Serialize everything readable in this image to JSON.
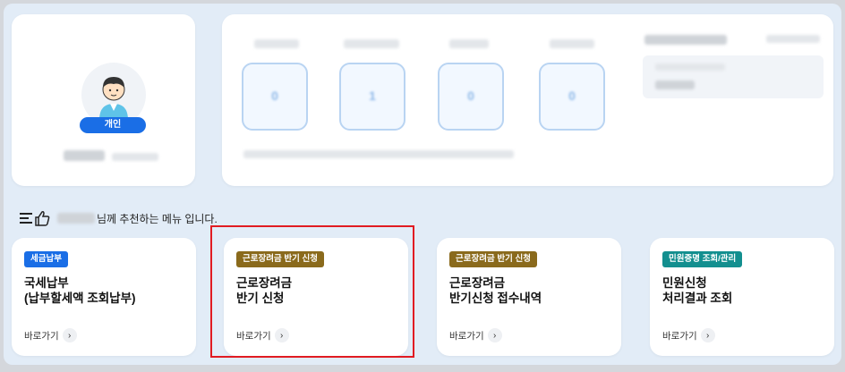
{
  "profile": {
    "type_badge": "개인"
  },
  "stats": {
    "boxes": [
      {
        "value": "0"
      },
      {
        "value": "1"
      },
      {
        "value": "0"
      },
      {
        "value": "0"
      }
    ]
  },
  "recommendation": {
    "text": "님께 추천하는 메뉴 입니다."
  },
  "menu_cards": [
    {
      "badge": "세금납부",
      "badge_color": "#1a6ee6",
      "title_line1": "국세납부",
      "title_line2": "(납부할세액 조회납부)",
      "link": "바로가기"
    },
    {
      "badge": "근로장려금 반기 신청",
      "badge_color": "#8a6a1c",
      "title_line1": "근로장려금",
      "title_line2": "반기 신청",
      "link": "바로가기"
    },
    {
      "badge": "근로장려금 반기 신청",
      "badge_color": "#8a6a1c",
      "title_line1": "근로장려금",
      "title_line2": "반기신청 접수내역",
      "link": "바로가기"
    },
    {
      "badge": "민원증명 조회/관리",
      "badge_color": "#138f8f",
      "title_line1": "민원신청",
      "title_line2": "처리결과 조회",
      "link": "바로가기"
    }
  ],
  "icons": {
    "avatar": "person-avatar-icon",
    "recommend": "list-thumbs-up-icon",
    "go_arrow": "chevron-right-icon"
  }
}
